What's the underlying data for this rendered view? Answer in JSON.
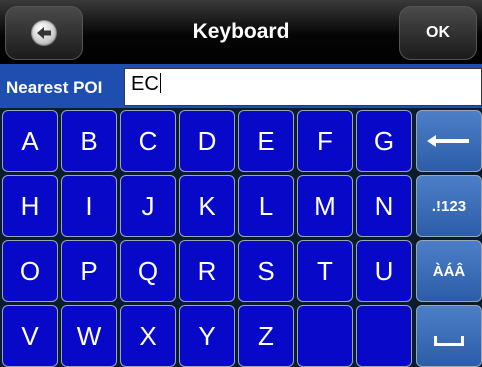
{
  "header": {
    "title": "Keyboard",
    "back_icon": "back-arrow-icon",
    "ok_label": "OK"
  },
  "input": {
    "label": "Nearest POI",
    "value": "EC"
  },
  "keyboard": {
    "rows": [
      [
        "A",
        "B",
        "C",
        "D",
        "E",
        "F",
        "G"
      ],
      [
        "H",
        "I",
        "J",
        "K",
        "L",
        "M",
        "N"
      ],
      [
        "O",
        "P",
        "Q",
        "R",
        "S",
        "T",
        "U"
      ],
      [
        "V",
        "W",
        "X",
        "Y",
        "Z",
        "",
        ""
      ]
    ],
    "function_keys": {
      "backspace_icon": "backspace-arrow-icon",
      "numbers_label": ".!123",
      "accents_label": "ÀÁÂ",
      "space_icon": "space-bar-icon"
    },
    "colors": {
      "letter_key": "#0808c8",
      "function_key": "#3a6cb8",
      "input_bar": "#1e4fb0"
    }
  }
}
